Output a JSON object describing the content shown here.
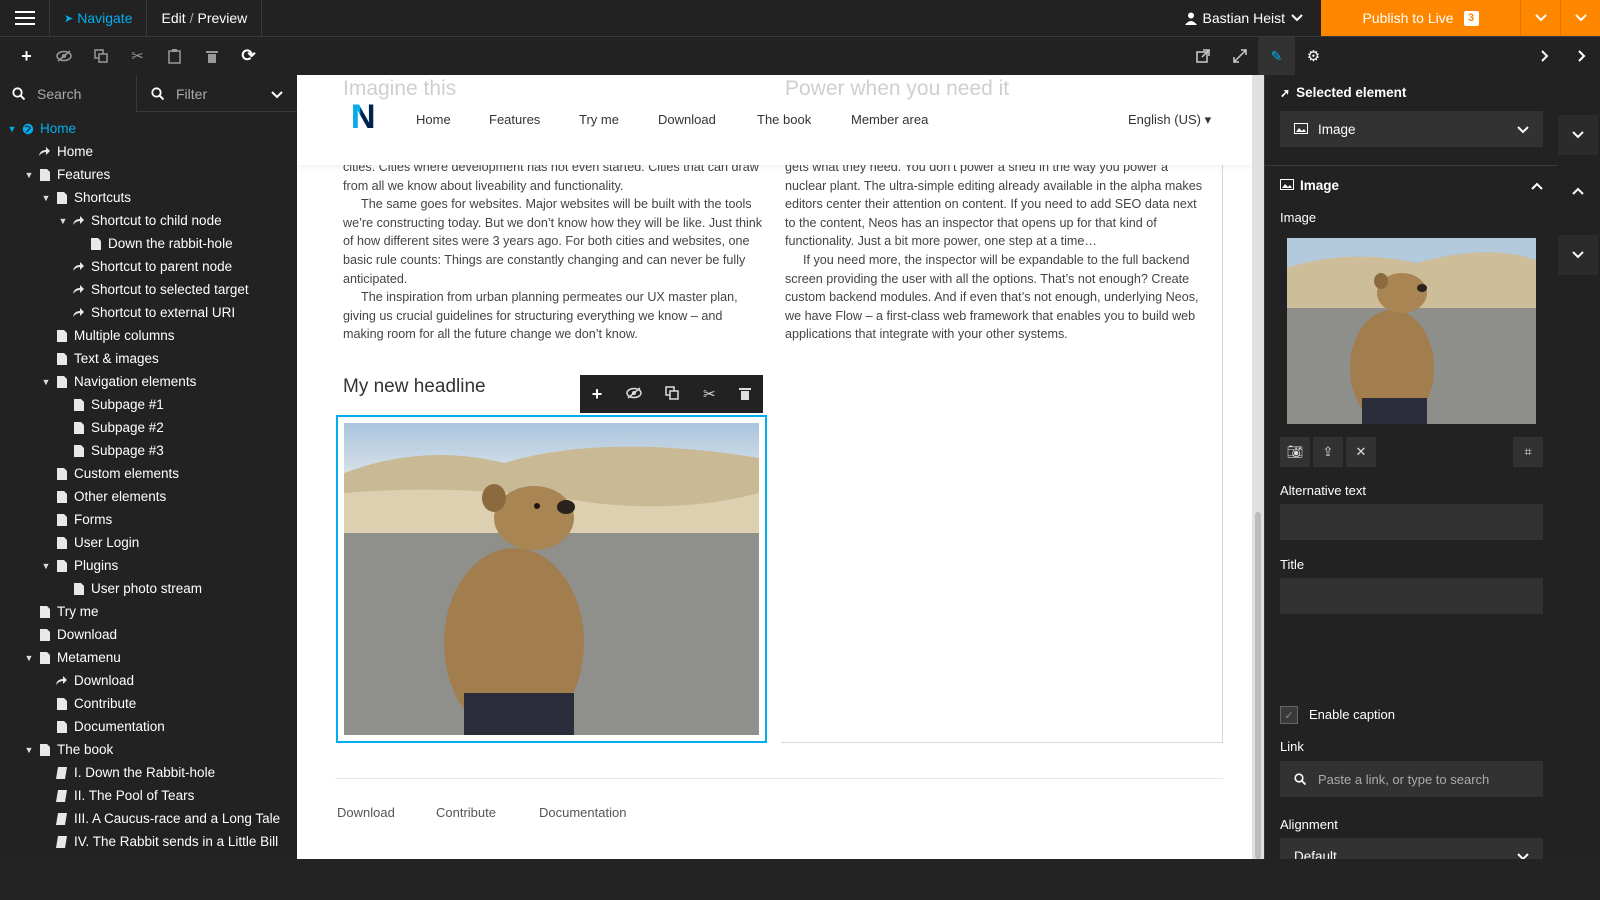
{
  "topbar": {
    "menu_icon": "hamburger-icon",
    "navigate_label": "Navigate",
    "edit_label": "Edit",
    "preview_label": "Preview",
    "user_name": "Bastian Heist",
    "publish_label": "Publish to Live",
    "publish_count": "3",
    "accent_color": "#ff8700",
    "active_color": "#00adee"
  },
  "sidebar": {
    "search_placeholder": "Search",
    "filter_label": "Filter",
    "tree": [
      {
        "label": "Home",
        "level": 0,
        "icon": "globe-icon",
        "toggle": "open",
        "active": true
      },
      {
        "label": "Home",
        "level": 1,
        "icon": "shortcut-icon",
        "toggle": ""
      },
      {
        "label": "Features",
        "level": 1,
        "icon": "page-icon",
        "toggle": "open"
      },
      {
        "label": "Shortcuts",
        "level": 2,
        "icon": "page-icon",
        "toggle": "open"
      },
      {
        "label": "Shortcut to child node",
        "level": 3,
        "icon": "shortcut-icon",
        "toggle": "open"
      },
      {
        "label": "Down the rabbit-hole",
        "level": 4,
        "icon": "page-icon",
        "toggle": ""
      },
      {
        "label": "Shortcut to parent node",
        "level": 3,
        "icon": "shortcut-icon",
        "toggle": ""
      },
      {
        "label": "Shortcut to selected target",
        "level": 3,
        "icon": "shortcut-icon",
        "toggle": ""
      },
      {
        "label": "Shortcut to external URI",
        "level": 3,
        "icon": "shortcut-icon",
        "toggle": ""
      },
      {
        "label": "Multiple columns",
        "level": 2,
        "icon": "page-icon",
        "toggle": ""
      },
      {
        "label": "Text & images",
        "level": 2,
        "icon": "page-icon",
        "toggle": ""
      },
      {
        "label": "Navigation elements",
        "level": 2,
        "icon": "page-icon",
        "toggle": "open"
      },
      {
        "label": "Subpage #1",
        "level": 3,
        "icon": "page-icon",
        "toggle": ""
      },
      {
        "label": "Subpage #2",
        "level": 3,
        "icon": "page-icon",
        "toggle": ""
      },
      {
        "label": "Subpage #3",
        "level": 3,
        "icon": "page-icon",
        "toggle": ""
      },
      {
        "label": "Custom elements",
        "level": 2,
        "icon": "page-icon",
        "toggle": ""
      },
      {
        "label": "Other elements",
        "level": 2,
        "icon": "page-icon",
        "toggle": ""
      },
      {
        "label": "Forms",
        "level": 2,
        "icon": "page-icon",
        "toggle": ""
      },
      {
        "label": "User Login",
        "level": 2,
        "icon": "page-icon",
        "toggle": ""
      },
      {
        "label": "Plugins",
        "level": 2,
        "icon": "page-icon",
        "toggle": "open"
      },
      {
        "label": "User photo stream",
        "level": 3,
        "icon": "page-icon",
        "toggle": ""
      },
      {
        "label": "Try me",
        "level": 1,
        "icon": "page-icon",
        "toggle": ""
      },
      {
        "label": "Download",
        "level": 1,
        "icon": "page-icon",
        "toggle": ""
      },
      {
        "label": "Metamenu",
        "level": 1,
        "icon": "page-icon",
        "toggle": "open"
      },
      {
        "label": "Download",
        "level": 2,
        "icon": "shortcut-icon",
        "toggle": ""
      },
      {
        "label": "Contribute",
        "level": 2,
        "icon": "page-icon",
        "toggle": ""
      },
      {
        "label": "Documentation",
        "level": 2,
        "icon": "page-icon",
        "toggle": ""
      },
      {
        "label": "The book",
        "level": 1,
        "icon": "page-icon",
        "toggle": "open"
      },
      {
        "label": "I. Down the Rabbit-hole",
        "level": 2,
        "icon": "chapter-icon",
        "toggle": ""
      },
      {
        "label": "II. The Pool of Tears",
        "level": 2,
        "icon": "chapter-icon",
        "toggle": ""
      },
      {
        "label": "III. A Caucus-race and a Long Tale",
        "level": 2,
        "icon": "chapter-icon",
        "toggle": ""
      },
      {
        "label": "IV. The Rabbit sends in a Little Bill",
        "level": 2,
        "icon": "chapter-icon",
        "toggle": ""
      }
    ]
  },
  "site": {
    "nav": [
      "Home",
      "Features",
      "Try me",
      "Download",
      "The book",
      "Member area"
    ],
    "language": "English (US) ▾",
    "ghost_left": "Imagine this",
    "ghost_right": "Power when you need it",
    "left_paragraphs": [
      "cities. Cities where development has not even started. Cities that can draw from all we know about liveability and functionality.",
      "The same goes for websites. Major websites will be built with the tools we’re constructing today. But we don’t know how they will be like. Just think of how different sites were 3 years ago. For both cities and websites, one basic rule counts: Things are constantly changing and can never be fully anticipated.",
      "The inspiration from urban planning permeates our UX master plan, giving us crucial guidelines for structuring everything we know  – and making room for all the future change we don’t know."
    ],
    "right_paragraphs": [
      "gets what they need. You don’t power a shed in the way you power a nuclear plant. The ultra-simple editing already available in the alpha makes editors center their attention on content. If you need to add SEO data next to the content, Neos has an inspector that opens up for that kind of functionality. Just a bit more power, one step at a time…",
      "If you need more, the inspector will be expandable to the full backend screen providing the user with all the options. That’s not enough? Create custom backend modules. And if even that’s not enough, underlying Neos, we have Flow – a first-class web framework that enables you to build web applications that integrate with your other systems."
    ],
    "headline": "My new headline",
    "footer_links": [
      "Download",
      "Contribute",
      "Documentation"
    ]
  },
  "inspector": {
    "selected_title": "Selected element",
    "selected_value": "Image",
    "section_title": "Image",
    "image_label": "Image",
    "alt_label": "Alternative text",
    "title_label": "Title",
    "caption_label": "Enable caption",
    "link_label": "Link",
    "link_placeholder": "Paste a link, or type to search",
    "alignment_label": "Alignment",
    "alignment_value": "Default"
  }
}
